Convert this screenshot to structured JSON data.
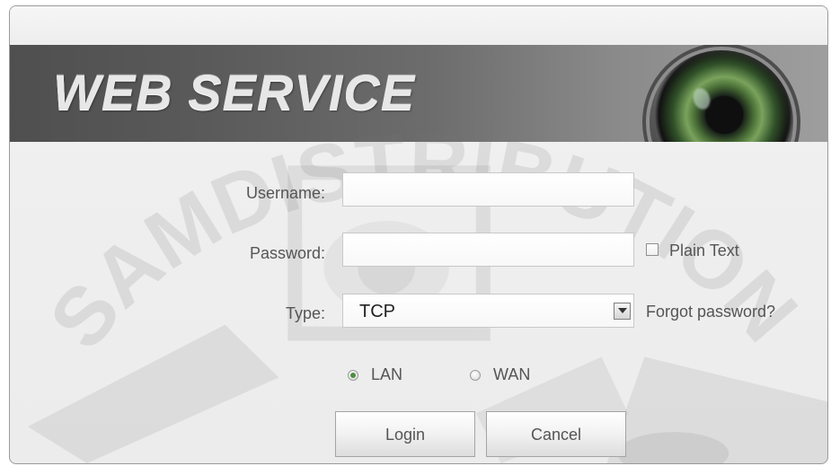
{
  "banner": {
    "title": "WEB SERVICE"
  },
  "form": {
    "username_label": "Username:",
    "username_value": "",
    "password_label": "Password:",
    "password_value": "",
    "plain_text_label": "Plain Text",
    "type_label": "Type:",
    "type_value": "TCP",
    "forgot_password_label": "Forgot password?"
  },
  "radio_options": [
    {
      "label": "LAN",
      "selected": true
    },
    {
      "label": "WAN",
      "selected": false
    }
  ],
  "buttons": {
    "login": "Login",
    "cancel": "Cancel"
  },
  "watermark": {
    "text": "SAMDISTRIBUTION, INC"
  },
  "colors": {
    "banner_dark": "#4f4f4f",
    "banner_light": "#9e9e9e",
    "radio_selected": "#4c8f40",
    "text_gray": "#555555"
  },
  "icons": {
    "dropdown": "chevron-down-icon",
    "checkbox": "checkbox-icon",
    "radio": "radio-icon",
    "camera": "camera-lens-icon"
  }
}
